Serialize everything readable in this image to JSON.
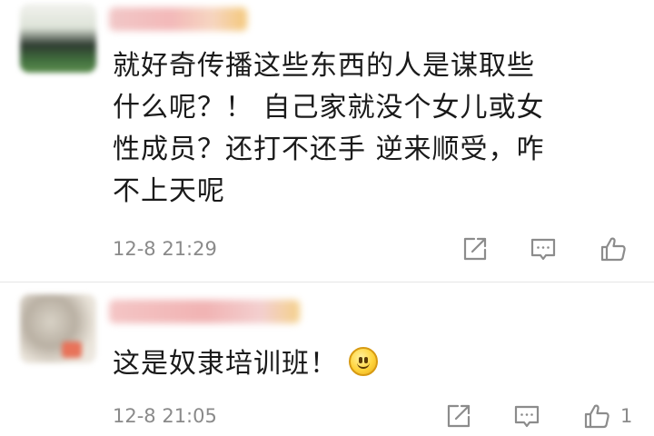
{
  "comments": [
    {
      "content_lines": [
        "就好奇传播这些东西的人是谋取些",
        "什么呢？！ 自己家就没个女儿或女",
        "性成员？还打不还手 逆来顺受，咋",
        "不上天呢"
      ],
      "timestamp": "12-8 21:29",
      "like_count": ""
    },
    {
      "content": "这是奴隶培训班！",
      "emoji": "smile-emoji",
      "timestamp": "12-8 21:05",
      "like_count": "1"
    }
  ],
  "icons": {
    "share": "share-icon",
    "reply": "comment-icon",
    "like": "thumbs-up-icon"
  },
  "colors": {
    "text": "#1a1a1a",
    "meta": "#8a8a8a",
    "icon": "#8c8c8c",
    "divider": "#e6e6e6"
  }
}
